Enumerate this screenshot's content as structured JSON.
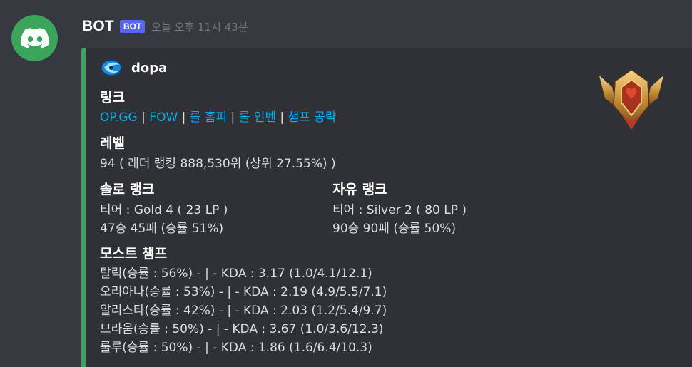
{
  "message": {
    "username": "BOT",
    "bot_tag": "BOT",
    "timestamp": "오늘 오후 11시 43분"
  },
  "embed": {
    "accent_color": "#3ba55c",
    "author": {
      "name": "dopa",
      "icon": "summoner-profile-icon"
    },
    "thumbnail": "gold-rank-emblem",
    "fields": {
      "link": {
        "name": "링크",
        "links": [
          "OP.GG",
          "FOW",
          "롤 홈피",
          "롤 인벤",
          "챔프 공략"
        ],
        "separator": "|"
      },
      "level": {
        "name": "레벨",
        "value": "94 ( 래더 랭킹 888,530위 (상위 27.55%) )"
      },
      "solo_rank": {
        "name": "솔로 랭크",
        "tier": "티어 : Gold 4 ( 23 LP )",
        "record": "47승 45패 (승률 51%)"
      },
      "flex_rank": {
        "name": "자유 랭크",
        "tier": "티어 : Silver 2 ( 80 LP )",
        "record": "90승 90패 (승률 50%)"
      },
      "most_champs": {
        "name": "모스트 챔프",
        "lines": [
          "탈릭(승률 : 56%) - | - KDA : 3.17 (1.0/4.1/12.1)",
          "오리아나(승률 : 53%) - | - KDA : 2.19 (4.9/5.5/7.1)",
          "알리스타(승률 : 42%) - | - KDA : 2.03 (1.2/5.4/9.7)",
          "브라움(승률 : 50%) - | - KDA : 3.67 (1.0/3.6/12.3)",
          "룰루(승률 : 50%) - | - KDA : 1.86 (1.6/6.4/10.3)"
        ]
      }
    }
  }
}
